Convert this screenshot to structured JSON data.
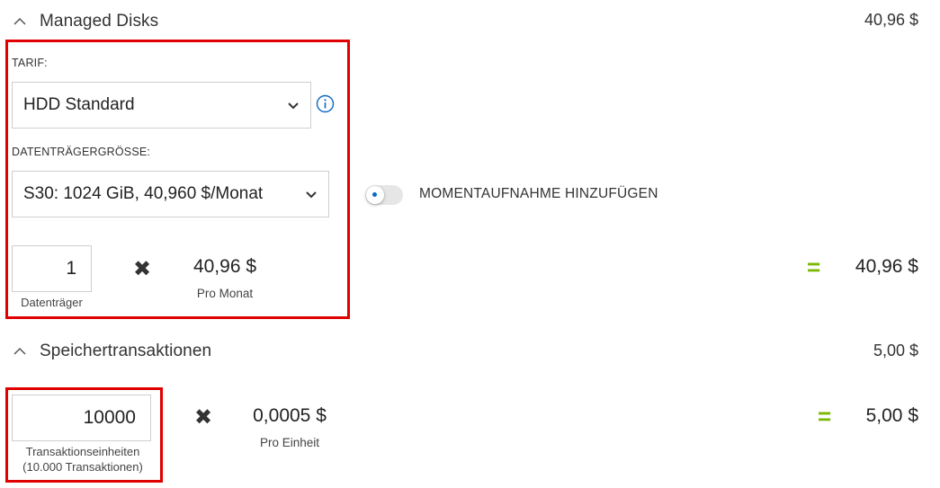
{
  "managed_disks": {
    "section_title": "Managed Disks",
    "section_total": "40,96 $",
    "tier_label": "TARIF:",
    "tier_value": "HDD Standard",
    "disk_size_label": "DATENTRÄGERGRÖSSE:",
    "disk_size_value": "S30: 1024 GiB, 40,960 $/Monat",
    "snapshot_label": "MOMENTAUFNAHME HINZUFÜGEN",
    "snapshot_enabled": false,
    "quantity": "1",
    "quantity_caption": "Datenträger",
    "unit_price": "40,96 $",
    "unit_price_caption": "Pro Monat",
    "line_total": "40,96 $"
  },
  "storage_transactions": {
    "section_title": "Speichertransaktionen",
    "section_total": "5,00 $",
    "quantity": "10000",
    "quantity_caption_line1": "Transaktionseinheiten",
    "quantity_caption_line2": "(10.000 Transaktionen)",
    "unit_price": "0,0005 $",
    "unit_price_caption": "Pro Einheit",
    "line_total": "5,00 $"
  },
  "symbols": {
    "times": "✖",
    "equals": "="
  },
  "colors": {
    "highlight_border": "#e00000",
    "equals_green": "#7ab800",
    "toggle_accent": "#0b67c2",
    "info_blue": "#0b67c2"
  },
  "icons": [
    "chevron-up-icon",
    "chevron-down-icon",
    "info-icon",
    "times-icon"
  ]
}
